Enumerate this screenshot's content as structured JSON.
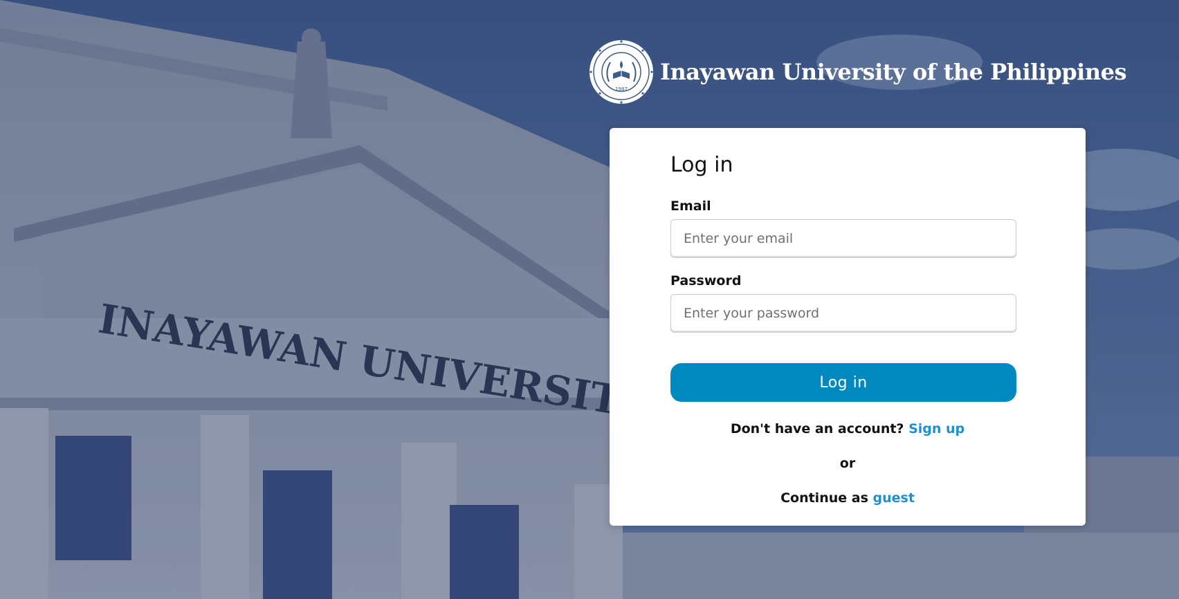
{
  "brand": {
    "name": "Inayawan University of the Philippines",
    "seal_text": "INAYAWAN UNIVERSITY OF THE PHILIPPINES",
    "seal_year": "1987"
  },
  "background": {
    "building_inscription": "INAYAWAN UNIVERSITY"
  },
  "login": {
    "title": "Log in",
    "email_label": "Email",
    "email_placeholder": "Enter your email",
    "email_value": "",
    "password_label": "Password",
    "password_placeholder": "Enter your password",
    "password_value": "",
    "submit_label": "Log in",
    "signup_prompt": "Don't have an account?",
    "signup_link": "Sign up",
    "or_text": "or",
    "guest_prompt": "Continue as",
    "guest_link": "guest"
  },
  "colors": {
    "primary_button": "#0089bf",
    "link": "#1f8fd2",
    "card_background": "#ffffff"
  }
}
